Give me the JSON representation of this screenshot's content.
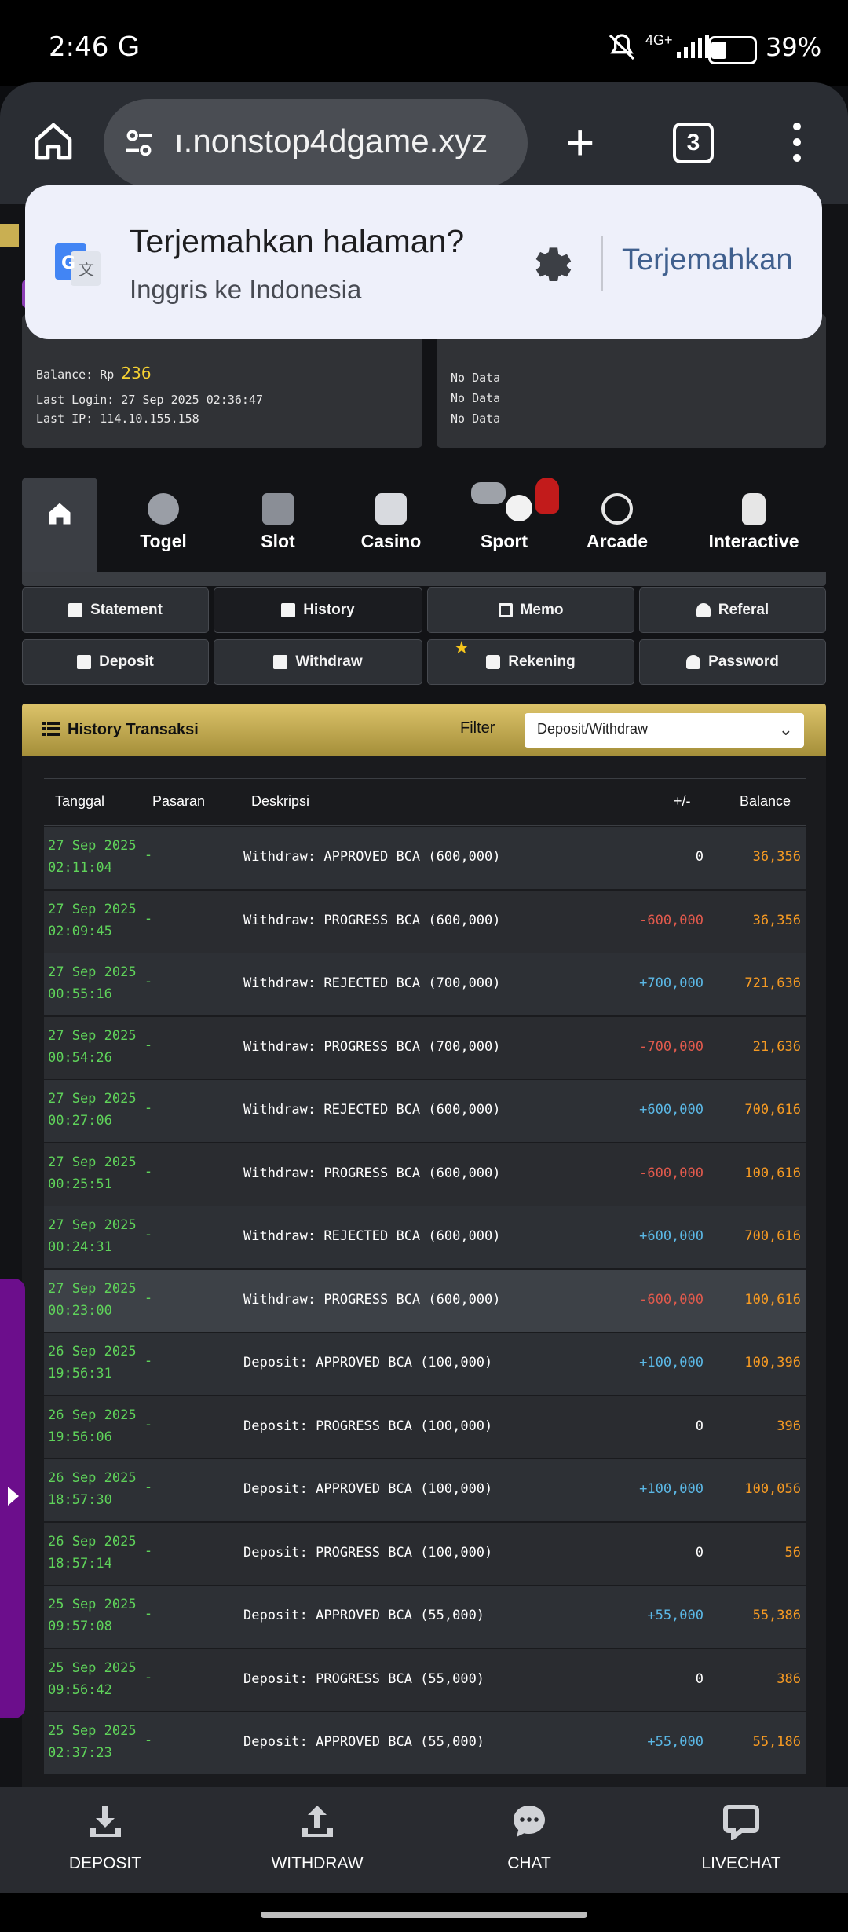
{
  "status_bar": {
    "time": "2:46",
    "network": "4G+",
    "battery_pct": "39%",
    "battery_level": 0.39
  },
  "browser": {
    "url": "ı.nonstop4dgame.xyz",
    "tab_count": "3"
  },
  "translate_popup": {
    "title": "Terjemahkan halaman?",
    "subtitle": "Inggris ke Indonesia",
    "action": "Terjemahkan"
  },
  "account": {
    "balance_label": "Balance: Rp",
    "balance_value": "236",
    "last_login": "Last Login: 27 Sep 2025 02:36:47",
    "last_ip": "Last IP: 114.10.155.158"
  },
  "last_bet": {
    "lines": [
      "No Data",
      "No Data",
      "No Data"
    ]
  },
  "categories": [
    "Togel",
    "Slot",
    "Casino",
    "Sport",
    "Arcade",
    "Interactive"
  ],
  "menu": {
    "row1": [
      "Statement",
      "History",
      "Memo",
      "Referal"
    ],
    "row2": [
      "Deposit",
      "Withdraw",
      "Rekening",
      "Password"
    ]
  },
  "history": {
    "title": "History Transaksi",
    "filter_label": "Filter",
    "filter_value": "Deposit/Withdraw",
    "columns": [
      "Tanggal",
      "Pasaran",
      "Deskripsi",
      "+/-",
      "Balance"
    ],
    "rows": [
      {
        "date": "27 Sep 2025",
        "time": "02:11:04",
        "pasaran": "-",
        "desc": "Withdraw: APPROVED BCA (600,000)",
        "amount": "0",
        "balance": "36,356"
      },
      {
        "date": "27 Sep 2025",
        "time": "02:09:45",
        "pasaran": "-",
        "desc": "Withdraw: PROGRESS BCA (600,000)",
        "amount": "-600,000",
        "balance": "36,356"
      },
      {
        "date": "27 Sep 2025",
        "time": "00:55:16",
        "pasaran": "-",
        "desc": "Withdraw: REJECTED BCA (700,000)",
        "amount": "+700,000",
        "balance": "721,636"
      },
      {
        "date": "27 Sep 2025",
        "time": "00:54:26",
        "pasaran": "-",
        "desc": "Withdraw: PROGRESS BCA (700,000)",
        "amount": "-700,000",
        "balance": "21,636"
      },
      {
        "date": "27 Sep 2025",
        "time": "00:27:06",
        "pasaran": "-",
        "desc": "Withdraw: REJECTED BCA (600,000)",
        "amount": "+600,000",
        "balance": "700,616"
      },
      {
        "date": "27 Sep 2025",
        "time": "00:25:51",
        "pasaran": "-",
        "desc": "Withdraw: PROGRESS BCA (600,000)",
        "amount": "-600,000",
        "balance": "100,616"
      },
      {
        "date": "27 Sep 2025",
        "time": "00:24:31",
        "pasaran": "-",
        "desc": "Withdraw: REJECTED BCA (600,000)",
        "amount": "+600,000",
        "balance": "700,616"
      },
      {
        "date": "27 Sep 2025",
        "time": "00:23:00",
        "pasaran": "-",
        "desc": "Withdraw: PROGRESS BCA (600,000)",
        "amount": "-600,000",
        "balance": "100,616"
      },
      {
        "date": "26 Sep 2025",
        "time": "19:56:31",
        "pasaran": "-",
        "desc": "Deposit: APPROVED BCA (100,000)",
        "amount": "+100,000",
        "balance": "100,396"
      },
      {
        "date": "26 Sep 2025",
        "time": "19:56:06",
        "pasaran": "-",
        "desc": "Deposit: PROGRESS BCA (100,000)",
        "amount": "0",
        "balance": "396"
      },
      {
        "date": "26 Sep 2025",
        "time": "18:57:30",
        "pasaran": "-",
        "desc": "Deposit: APPROVED BCA (100,000)",
        "amount": "+100,000",
        "balance": "100,056"
      },
      {
        "date": "26 Sep 2025",
        "time": "18:57:14",
        "pasaran": "-",
        "desc": "Deposit: PROGRESS BCA (100,000)",
        "amount": "0",
        "balance": "56"
      },
      {
        "date": "25 Sep 2025",
        "time": "09:57:08",
        "pasaran": "-",
        "desc": "Deposit: APPROVED BCA (55,000)",
        "amount": "+55,000",
        "balance": "55,386"
      },
      {
        "date": "25 Sep 2025",
        "time": "09:56:42",
        "pasaran": "-",
        "desc": "Deposit: PROGRESS BCA (55,000)",
        "amount": "0",
        "balance": "386"
      },
      {
        "date": "25 Sep 2025",
        "time": "02:37:23",
        "pasaran": "-",
        "desc": "Deposit: APPROVED BCA (55,000)",
        "amount": "+55,000",
        "balance": "55,186"
      }
    ]
  },
  "bottom_nav": [
    "DEPOSIT",
    "WITHDRAW",
    "CHAT",
    "LIVECHAT"
  ],
  "colors": {
    "positive": "#5bb8e6",
    "negative": "#e25a4d",
    "neutral": "#ffffff",
    "balance": "#f59a23",
    "date": "#5fd35a",
    "accent_gold": "#c9af52"
  }
}
